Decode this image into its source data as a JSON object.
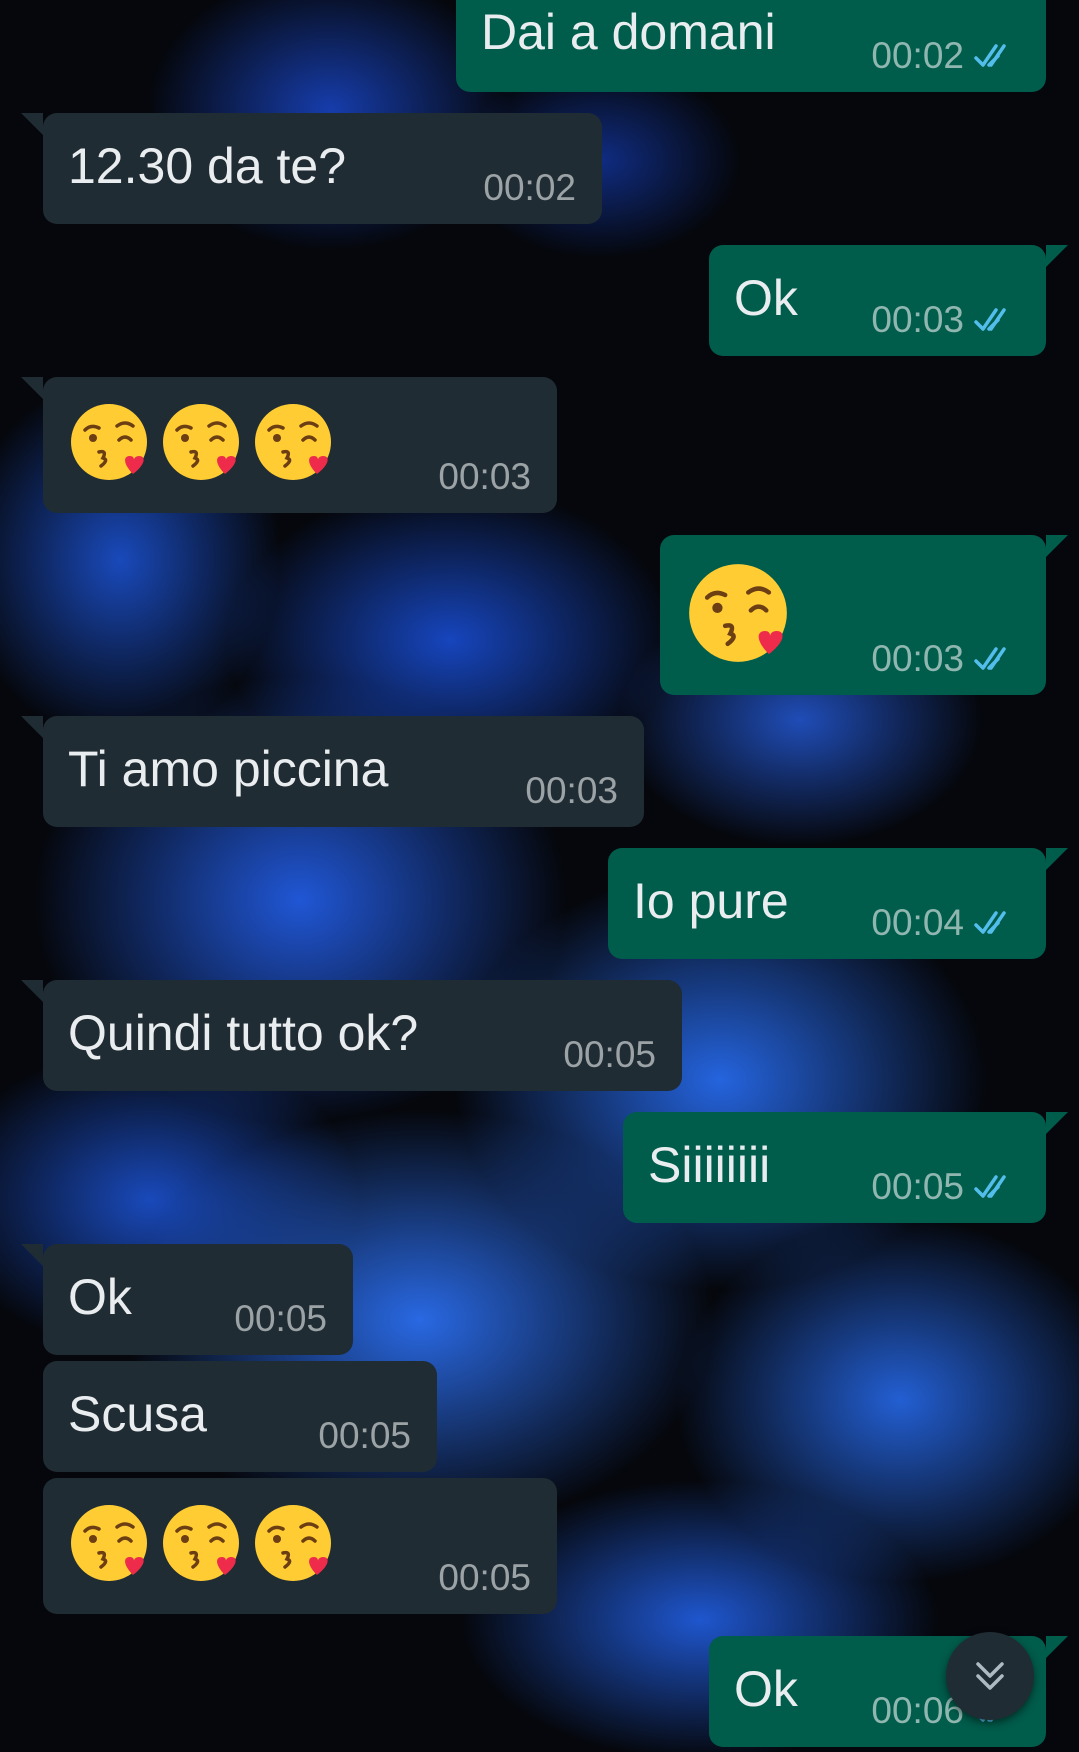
{
  "messages": [
    {
      "direction": "out",
      "text": "Dai a domani",
      "time": "00:02",
      "status": "read"
    },
    {
      "direction": "in",
      "text": "12.30 da te?",
      "time": "00:02"
    },
    {
      "direction": "out",
      "text": "Ok",
      "time": "00:03",
      "status": "read"
    },
    {
      "direction": "in",
      "emoji": [
        "face-blowing-a-kiss",
        "face-blowing-a-kiss",
        "face-blowing-a-kiss"
      ],
      "time": "00:03"
    },
    {
      "direction": "out",
      "emoji": [
        "face-blowing-a-kiss"
      ],
      "time": "00:03",
      "status": "read"
    },
    {
      "direction": "in",
      "text": "Ti amo piccina",
      "time": "00:03"
    },
    {
      "direction": "out",
      "text": "Io pure",
      "time": "00:04",
      "status": "read"
    },
    {
      "direction": "in",
      "text": "Quindi tutto ok?",
      "time": "00:05"
    },
    {
      "direction": "out",
      "text": "Siiiiiiii",
      "time": "00:05",
      "status": "read"
    },
    {
      "direction": "in",
      "text": "Ok",
      "time": "00:05"
    },
    {
      "direction": "in",
      "text": "Scusa",
      "time": "00:05"
    },
    {
      "direction": "in",
      "emoji": [
        "face-blowing-a-kiss",
        "face-blowing-a-kiss",
        "face-blowing-a-kiss"
      ],
      "time": "00:05"
    },
    {
      "direction": "out",
      "text": "Ok",
      "time": "00:06",
      "status": "read"
    }
  ],
  "colors": {
    "incoming_bubble": "#202c33",
    "outgoing_bubble": "#005c4b",
    "read_ticks": "#53bdeb",
    "wallpaper_ink": "#2a64e6"
  },
  "icons": {
    "read_receipt": "double-check-icon",
    "scroll_down": "double-chevron-down-icon",
    "emoji": "face-blowing-a-kiss"
  }
}
